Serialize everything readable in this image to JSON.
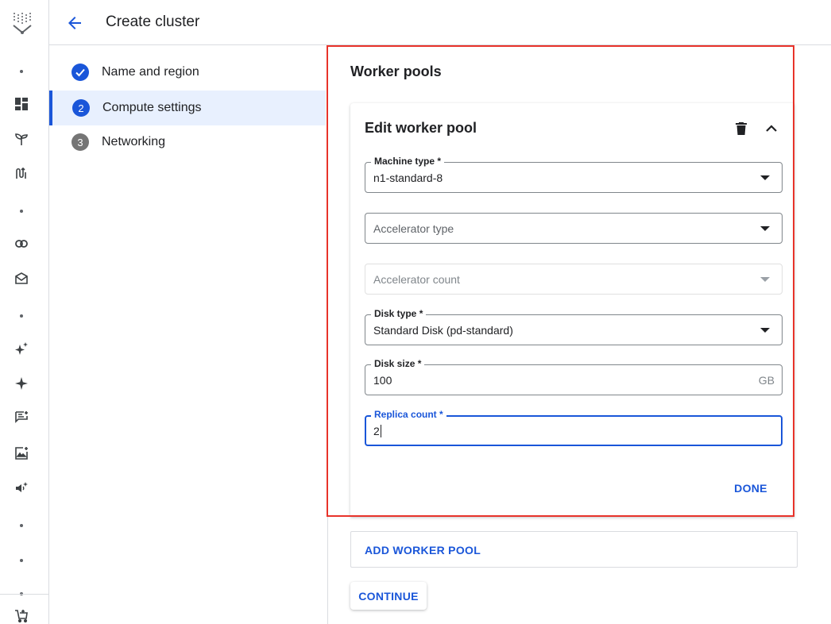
{
  "header": {
    "title": "Create cluster"
  },
  "steps": [
    {
      "number": "",
      "label": "Name and region",
      "state": "completed"
    },
    {
      "number": "2",
      "label": "Compute settings",
      "state": "active"
    },
    {
      "number": "3",
      "label": "Networking",
      "state": "pending"
    }
  ],
  "section": {
    "title": "Worker pools"
  },
  "card": {
    "title": "Edit worker pool",
    "machine_type": {
      "label": "Machine type *",
      "value": "n1-standard-8"
    },
    "accelerator_type": {
      "placeholder": "Accelerator type"
    },
    "accelerator_count": {
      "placeholder": "Accelerator count"
    },
    "disk_type": {
      "label": "Disk type *",
      "value": "Standard Disk (pd-standard)"
    },
    "disk_size": {
      "label": "Disk size *",
      "value": "100",
      "suffix": "GB"
    },
    "replica_count": {
      "label": "Replica count *",
      "value": "2"
    },
    "done_label": "DONE"
  },
  "add_worker_pool_label": "ADD WORKER POOL",
  "continue_label": "CONTINUE",
  "colors": {
    "accent": "#1a56d9",
    "highlight": "#e8332a",
    "step_complete": "#1a56d9",
    "step_pending": "#757575"
  },
  "rail_icons": [
    "dashboard-icon",
    "sprout-icon",
    "pipeline-icon",
    "link-icon",
    "tag-icon",
    "sparkle-plus-icon",
    "sparkle-icon",
    "notes-icon",
    "image-edit-icon",
    "speaker-icon",
    "cart-icon"
  ]
}
